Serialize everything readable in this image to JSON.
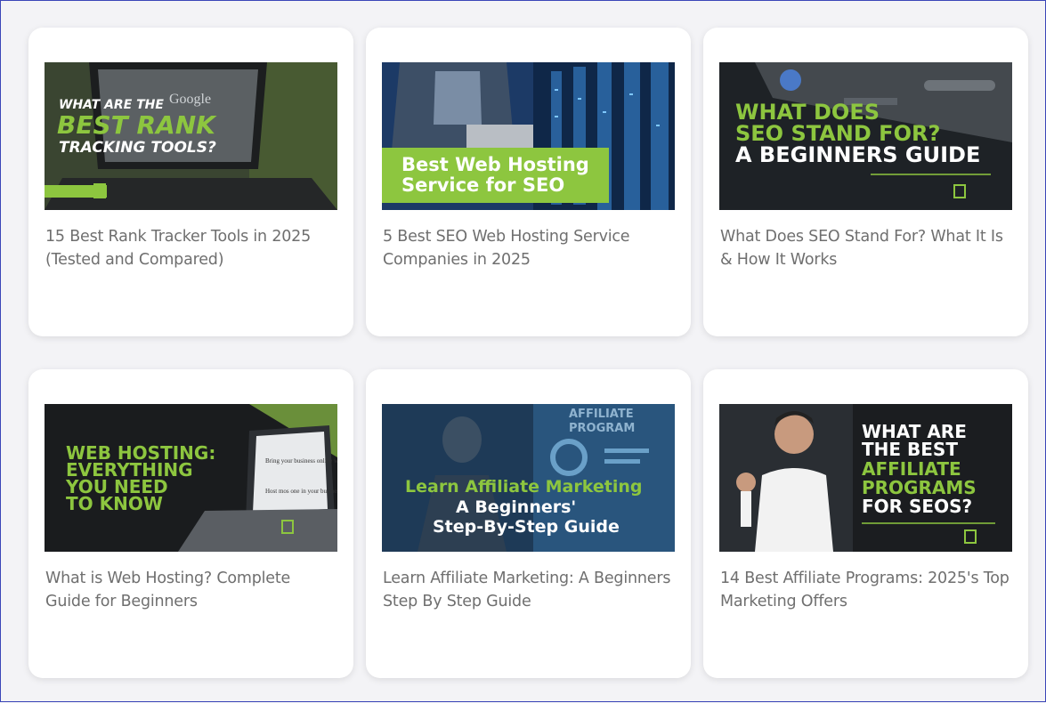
{
  "colors": {
    "accent_green": "#8dc63f",
    "title_gray": "#6f6f6f",
    "card_bg": "#ffffff",
    "page_bg": "#f3f3f6"
  },
  "cards": [
    {
      "title": "15 Best Rank Tracker Tools in 2025 (Tested and Compared)",
      "thumb_lines": [
        "WHAT ARE THE",
        "BEST RANK",
        "TRACKING TOOLS?"
      ],
      "thumb_logo_text": "Google"
    },
    {
      "title": "5 Best SEO Web Hosting Service Companies in 2025",
      "thumb_lines": [
        "Best Web Hosting",
        "Service for SEO"
      ]
    },
    {
      "title": "What Does SEO Stand For? What It Is & How It Works",
      "thumb_lines": [
        "WHAT DOES",
        "SEO STAND FOR?",
        "A BEGINNERS GUIDE"
      ]
    },
    {
      "title": "What is Web Hosting? Complete Guide for Beginners",
      "thumb_lines": [
        "WEB HOSTING:",
        "EVERYTHING",
        "YOU NEED",
        "TO KNOW"
      ],
      "thumb_screen_lines": [
        "Bring your business online with a custom",
        "Host mos one in your business"
      ]
    },
    {
      "title": "Learn Affiliate Marketing: A Beginners Step By Step Guide",
      "thumb_lines": [
        "Learn Affiliate Marketing",
        "A Beginners'",
        "Step-By-Step Guide"
      ],
      "thumb_bg_lines": [
        "AFFILIATE",
        "PROGRAM"
      ]
    },
    {
      "title": "14 Best Affiliate Programs: 2025's Top Marketing Offers",
      "thumb_lines": [
        "WHAT ARE",
        "THE BEST",
        "AFFILIATE",
        "PROGRAMS",
        "FOR SEOS?"
      ]
    }
  ]
}
